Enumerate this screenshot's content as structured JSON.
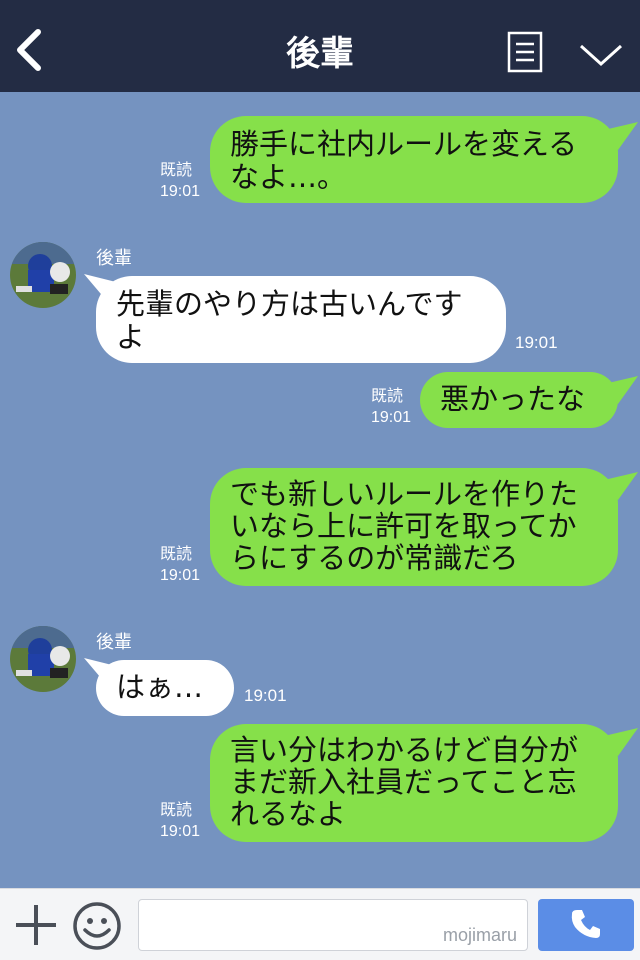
{
  "header": {
    "title": "後輩",
    "back_icon": "chevron-left-icon",
    "memo_icon": "memo-icon",
    "menu_icon": "chevron-down-icon"
  },
  "messages": [
    {
      "side": "me",
      "text": "勝手に社内ルールを変える\nなよ…。",
      "read": "既読",
      "time": "19:01"
    },
    {
      "side": "them",
      "sender": "後輩",
      "text": "先輩のやり方は古いんです\nよ",
      "time": "19:01"
    },
    {
      "side": "me",
      "text": "悪かったな",
      "read": "既読",
      "time": "19:01"
    },
    {
      "side": "me",
      "text": "でも新しいルールを作りた\nいなら上に許可を取ってか\nらにするのが常識だろ",
      "read": "既読",
      "time": "19:01"
    },
    {
      "side": "them",
      "sender": "後輩",
      "text": "はぁ…",
      "time": "19:01"
    },
    {
      "side": "me",
      "text": "言い分はわかるけど自分が\nまだ新入社員だってこと忘\nれるなよ",
      "read": "既読",
      "time": "19:01"
    }
  ],
  "footer": {
    "input_value": "",
    "watermark": "mojimaru",
    "plus_icon": "plus-icon",
    "sticker_icon": "smiley-icon",
    "call_icon": "phone-icon"
  },
  "colors": {
    "header_bg": "#232c44",
    "chat_bg": "#7593c0",
    "my_bubble": "#86e04a",
    "their_bubble": "#ffffff",
    "call_button": "#5b8de6"
  }
}
